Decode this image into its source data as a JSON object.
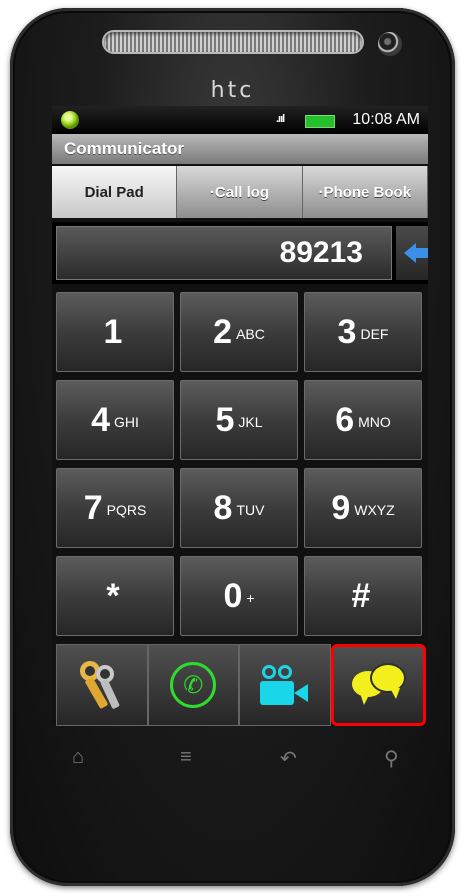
{
  "device": {
    "brand": "htc"
  },
  "status_bar": {
    "signal": ".ııl",
    "time": "10:08 AM"
  },
  "app": {
    "title": "Communicator"
  },
  "tabs": [
    {
      "label": "Dial Pad"
    },
    {
      "label": "·Call log"
    },
    {
      "label": "·Phone Book"
    }
  ],
  "dialer": {
    "number": "89213"
  },
  "keypad": [
    {
      "digit": "1",
      "letters": ""
    },
    {
      "digit": "2",
      "letters": "ABC"
    },
    {
      "digit": "3",
      "letters": "DEF"
    },
    {
      "digit": "4",
      "letters": "GHI"
    },
    {
      "digit": "5",
      "letters": "JKL"
    },
    {
      "digit": "6",
      "letters": "MNO"
    },
    {
      "digit": "7",
      "letters": "PQRS"
    },
    {
      "digit": "8",
      "letters": "TUV"
    },
    {
      "digit": "9",
      "letters": "WXYZ"
    },
    {
      "digit": "*",
      "letters": ""
    },
    {
      "digit": "0",
      "letters": "+"
    },
    {
      "digit": "#",
      "letters": ""
    }
  ],
  "actions": [
    {
      "icon": "keys-icon"
    },
    {
      "icon": "phone-call-icon"
    },
    {
      "icon": "video-camera-icon"
    },
    {
      "icon": "chat-bubbles-icon",
      "selected": true
    }
  ],
  "hardware_nav": {
    "home": "⌂",
    "menu": "≡",
    "back": "↶",
    "search": "⚲"
  },
  "colors": {
    "highlight": "#ff0000",
    "accent_blue": "#3a8fe8"
  }
}
